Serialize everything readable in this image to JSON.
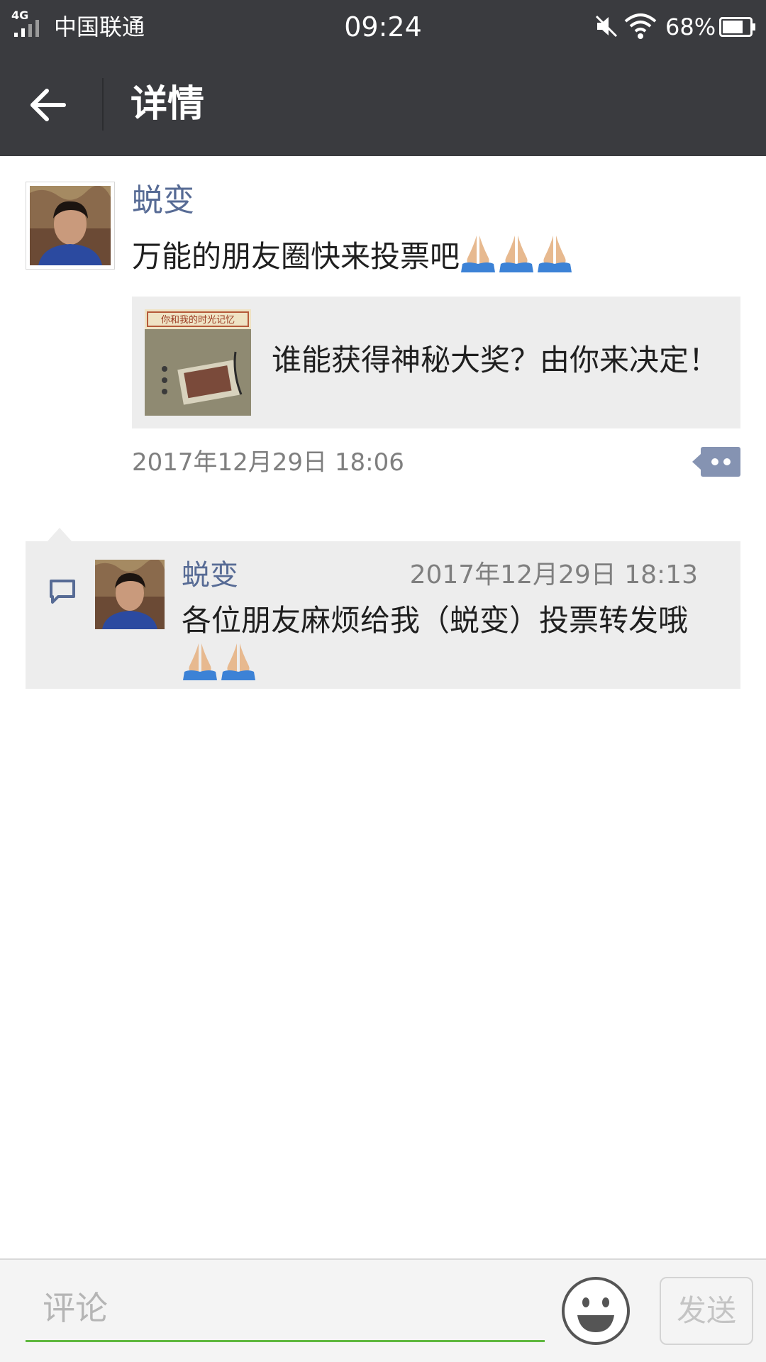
{
  "status_bar": {
    "network": "4G",
    "carrier": "中国联通",
    "time": "09:24",
    "battery": "68%"
  },
  "header": {
    "title": "详情"
  },
  "post": {
    "author": "蜕变",
    "text": "万能的朋友圈快来投票吧",
    "emoji": [
      "pray-emoji",
      "pray-emoji",
      "pray-emoji"
    ],
    "link_card": {
      "thumb_caption": "你和我的时光记忆",
      "title": "谁能获得神秘大奖？由你来决定！"
    },
    "time": "2017年12月29日 18:06"
  },
  "comments": [
    {
      "author": "蜕变",
      "time": "2017年12月29日 18:13",
      "text": "各位朋友麻烦给我（蜕变）投票转发哦",
      "emoji": [
        "pray-emoji",
        "pray-emoji"
      ]
    }
  ],
  "input_bar": {
    "placeholder": "评论",
    "send_label": "发送"
  },
  "colors": {
    "bar_background": "#3a3b3f",
    "name_link": "#576b95",
    "input_underline": "#5fb83f",
    "card_background": "#ededed"
  }
}
